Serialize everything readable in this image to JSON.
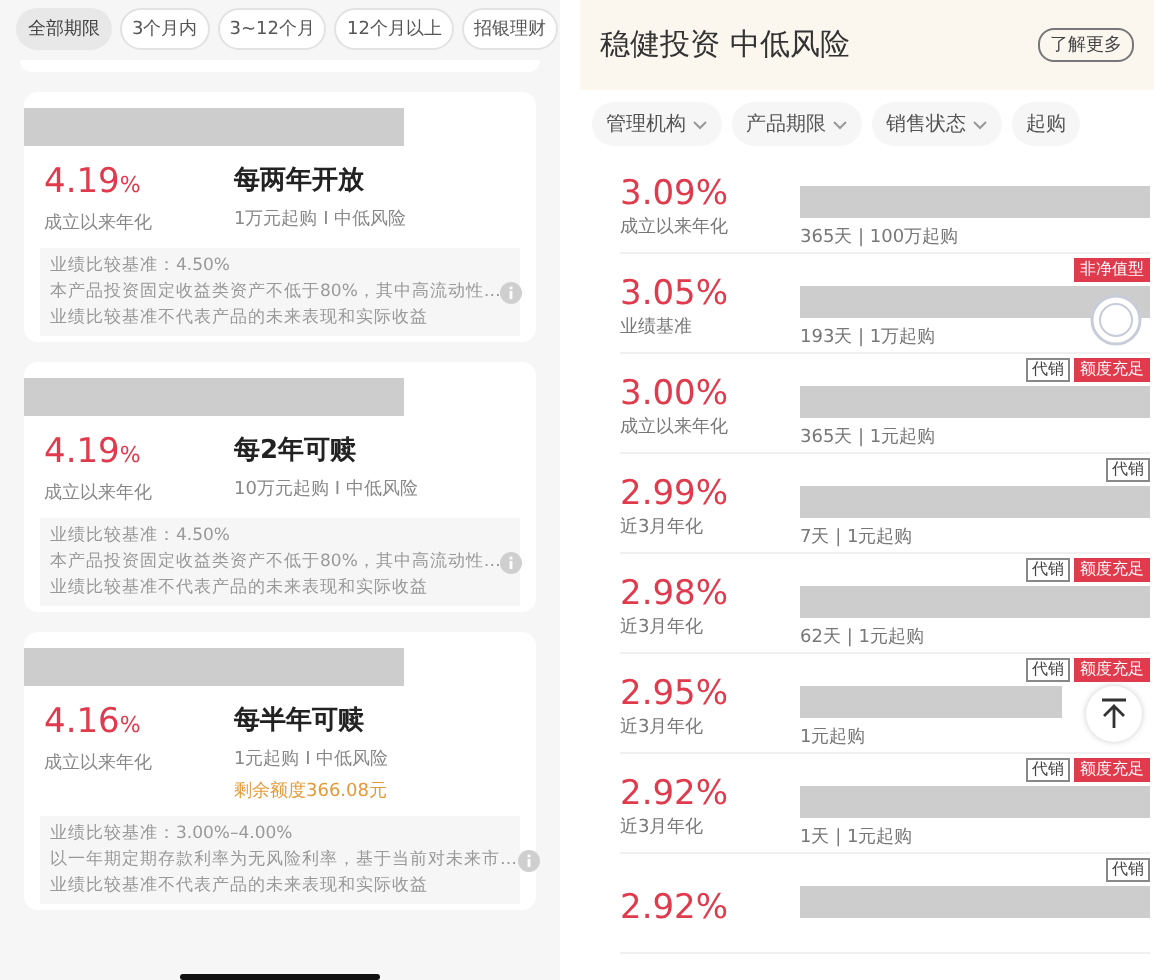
{
  "left_panel": {
    "filters": [
      {
        "label": "全部期限",
        "selected": true
      },
      {
        "label": "3个月内",
        "selected": false
      },
      {
        "label": "3~12个月",
        "selected": false
      },
      {
        "label": "12个月以上",
        "selected": false
      },
      {
        "label": "招银理财",
        "selected": false
      }
    ],
    "products": [
      {
        "rate": "4.19",
        "unit": "%",
        "rate_label": "成立以来年化",
        "title": "每两年开放",
        "terms": "1万元起购 I 中低风险",
        "benchmark": "业绩比较基准：4.50%",
        "note": "本产品投资固定收益类资产不低于80%，其中高流动性…",
        "disclaimer": "业绩比较基准不代表产品的未来表现和实际收益"
      },
      {
        "rate": "4.19",
        "unit": "%",
        "rate_label": "成立以来年化",
        "title": "每2年可赎",
        "terms": "10万元起购 I 中低风险",
        "benchmark": "业绩比较基准：4.50%",
        "note": "本产品投资固定收益类资产不低于80%，其中高流动性…",
        "disclaimer": "业绩比较基准不代表产品的未来表现和实际收益"
      },
      {
        "rate": "4.16",
        "unit": "%",
        "rate_label": "成立以来年化",
        "title": "每半年可赎",
        "terms": "1元起购 I 中低风险",
        "quota": "剩余额度366.08元",
        "benchmark": "业绩比较基准：3.00%–4.00%",
        "note": "以一年期定期存款利率为无风险利率，基于当前对未来市…",
        "disclaimer": "业绩比较基准不代表产品的未来表现和实际收益"
      }
    ]
  },
  "right_panel": {
    "title": "稳健投资 中低风险",
    "learn_more": "了解更多",
    "filters": [
      "管理机构",
      "产品期限",
      "销售状态",
      "起购"
    ],
    "products": [
      {
        "rate": "3.09%",
        "rate_label": "成立以来年化",
        "terms": "365天 | 100万起购",
        "sold_out": false
      },
      {
        "rate": "3.05%",
        "rate_label": "业绩基准",
        "terms": "193天 | 1万起购",
        "tags": [
          {
            "text": "非净值型",
            "kind": "filled"
          }
        ],
        "sold_out": true
      },
      {
        "rate": "3.00%",
        "rate_label": "成立以来年化",
        "terms": "365天 | 1元起购",
        "tags": [
          {
            "text": "代销",
            "kind": "outline"
          },
          {
            "text": "额度充足",
            "kind": "filled"
          }
        ],
        "sold_out": false
      },
      {
        "rate": "2.99%",
        "rate_label": "近3月年化",
        "terms": "7天 | 1元起购",
        "tags": [
          {
            "text": "代销",
            "kind": "outline"
          }
        ],
        "sold_out": false
      },
      {
        "rate": "2.98%",
        "rate_label": "近3月年化",
        "terms": "62天 | 1元起购",
        "tags": [
          {
            "text": "代销",
            "kind": "outline"
          },
          {
            "text": "额度充足",
            "kind": "filled"
          }
        ],
        "sold_out": false
      },
      {
        "rate": "2.95%",
        "rate_label": "近3月年化",
        "terms": "1元起购",
        "tags": [
          {
            "text": "代销",
            "kind": "outline"
          },
          {
            "text": "额度充足",
            "kind": "filled"
          }
        ],
        "sold_out": false
      },
      {
        "rate": "2.92%",
        "rate_label": "近3月年化",
        "terms": "1天 | 1元起购",
        "tags": [
          {
            "text": "代销",
            "kind": "outline"
          },
          {
            "text": "额度充足",
            "kind": "filled"
          }
        ],
        "sold_out": false
      },
      {
        "rate": "2.92%",
        "tags": [
          {
            "text": "代销",
            "kind": "outline"
          }
        ],
        "sold_out": false
      }
    ]
  }
}
